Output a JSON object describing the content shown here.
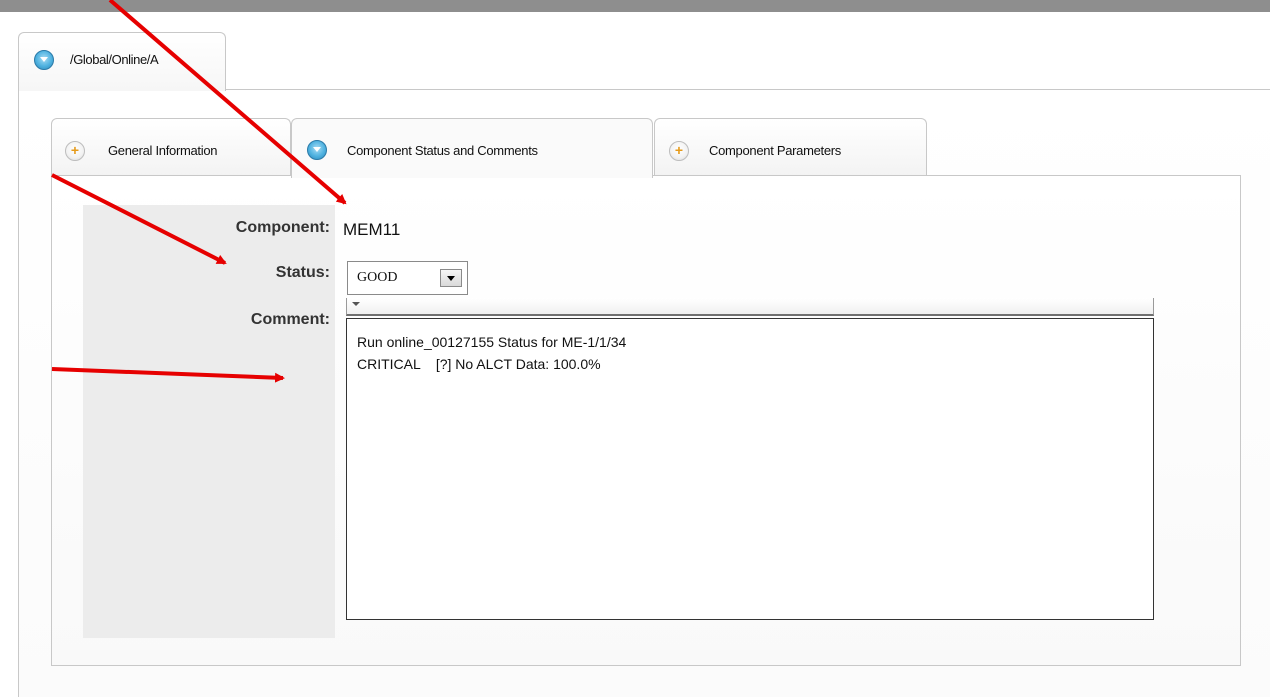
{
  "outer_tab": {
    "label": "/Global/Online/A"
  },
  "tabs": [
    {
      "label": "General Information",
      "icon": "plus-icon",
      "active": false
    },
    {
      "label": "Component Status and Comments",
      "icon": "collapse-icon",
      "active": true
    },
    {
      "label": "Component Parameters",
      "icon": "plus-icon",
      "active": false
    }
  ],
  "form": {
    "component_label": "Component:",
    "component_value": "MEM11",
    "status_label": "Status:",
    "status_value": "GOOD",
    "comment_label": "Comment:",
    "comment_text": "Run online_00127155 Status for ME-1/1/34\nCRITICAL    [?] No ALCT Data: 100.0%"
  },
  "colors": {
    "annotation_arrow": "#e60000",
    "tab_icon_blue": "#4fb2e0",
    "plus_icon_orange": "#e59a1a"
  }
}
